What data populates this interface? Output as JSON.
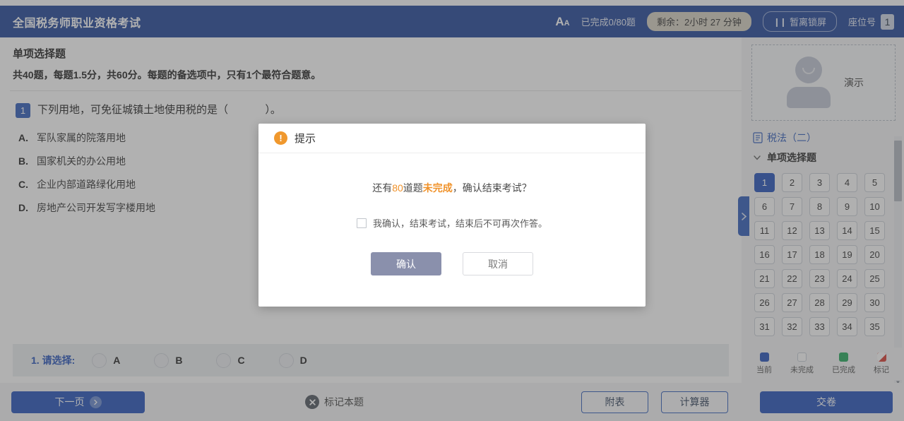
{
  "header": {
    "title": "全国税务师职业资格考试",
    "font_icon": "font-size-icon",
    "progress": "已完成0/80题",
    "timer": "剩余：2小时 27 分钟",
    "pause_glyph": "❙❙",
    "pause_label": "暂离锁屏",
    "seat_label": "座位号",
    "seat_number": "1",
    "bg_color": "#2c4f9e"
  },
  "content": {
    "section_title": "单项选择题",
    "section_subtitle": "共40题，每题1.5分，共60分。每题的备选项中，只有1个最符合题意。",
    "question": {
      "number": "1",
      "prefix": "下列用地，可免征城镇土地使用税的是（",
      "suffix": "）。",
      "options": [
        {
          "key": "A.",
          "text": "军队家属的院落用地"
        },
        {
          "key": "B.",
          "text": "国家机关的办公用地"
        },
        {
          "key": "C.",
          "text": "企业内部道路绿化用地"
        },
        {
          "key": "D.",
          "text": "房地产公司开发写字楼用地"
        }
      ]
    },
    "answer_bar": {
      "label": "1. 请选择:",
      "choices": [
        "A",
        "B",
        "C",
        "D"
      ]
    },
    "collapse_handle_icon": "chevron-right-icon"
  },
  "sidebar": {
    "avatar_icon": "user-avatar-icon",
    "candidate_name": "演示",
    "subject_icon": "document-icon",
    "subject": "税法（二）",
    "group_chevron": "chevron-down-icon",
    "group": "单项选择题",
    "questions": [
      "1",
      "2",
      "3",
      "4",
      "5",
      "6",
      "7",
      "8",
      "9",
      "10",
      "11",
      "12",
      "13",
      "14",
      "15",
      "16",
      "17",
      "18",
      "19",
      "20",
      "21",
      "22",
      "23",
      "24",
      "25",
      "26",
      "27",
      "28",
      "29",
      "30",
      "31",
      "32",
      "33",
      "34",
      "35"
    ],
    "current_question": "1",
    "legend": [
      {
        "label": "当前",
        "color": "#2f5bbd"
      },
      {
        "label": "未完成",
        "color": "#fdfdfd"
      },
      {
        "label": "已完成",
        "color": "#2eac62"
      },
      {
        "label": "标记",
        "color": "#d8443c"
      }
    ]
  },
  "toolbar": {
    "next_label": "下一页",
    "next_icon": "chevron-right-circle-icon",
    "mark_icon": "flag-mark-icon",
    "mark_label": "标记本题",
    "attachment_label": "附表",
    "calculator_label": "计算器",
    "submit_label": "交卷"
  },
  "modal": {
    "icon": "warning-icon",
    "icon_glyph": "!",
    "title": "提示",
    "message_part1": "还有",
    "message_count": "80",
    "message_part2": "道题",
    "message_status": "未完成",
    "message_part3": "，确认结束考试？",
    "checkbox_label": "我确认，结束考试，结束后不可再次作答。",
    "checkbox_checked": false,
    "confirm_label": "确认",
    "cancel_label": "取消",
    "accent_color": "#f0922a"
  }
}
